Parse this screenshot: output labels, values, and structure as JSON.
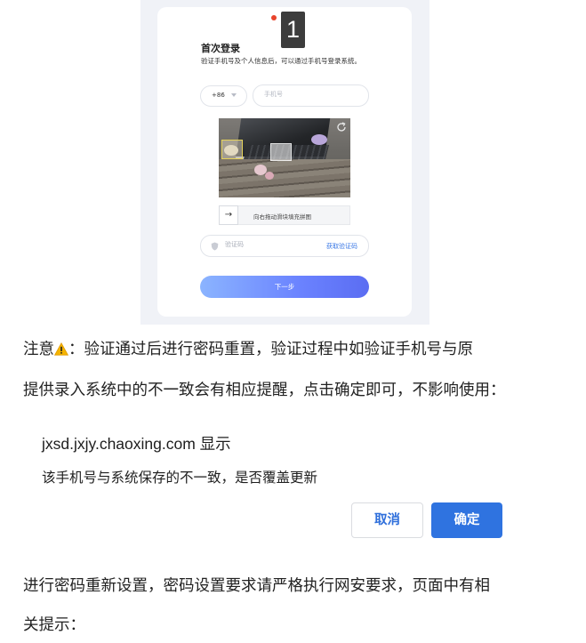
{
  "login": {
    "step_number": "1",
    "title": "首次登录",
    "subtitle": "验证手机号及个人信息后，可以通过手机号登录系统。",
    "country_code": "+86",
    "phone_placeholder": "手机号",
    "slider_hint": "向右拖动滑块填充拼图",
    "slider_arrow": "→",
    "code_placeholder": "验证码",
    "get_code_label": "获取验证码",
    "next_label": "下一步"
  },
  "para1": {
    "line1_before": "注意",
    "line1_after": "：验证通过后进行密码重置，验证过程中如验证手机号与原",
    "line2": "提供录入系统中的不一致会有相应提醒，点击确定即可，不影响使用："
  },
  "dialog": {
    "host": "jxsd.jxjy.chaoxing.com 显示",
    "message": "该手机号与系统保存的不一致，是否覆盖更新",
    "cancel_label": "取消",
    "ok_label": "确定"
  },
  "para2": {
    "line1": "进行密码重新设置，密码设置要求请严格执行网安要求，页面中有相",
    "line2": "关提示："
  },
  "colors": {
    "accent_blue": "#2f73e0",
    "gradient_start": "#8bb4ff",
    "gradient_end": "#5b6df2",
    "warning_yellow": "#f5b400"
  },
  "icons": [
    "refresh-icon",
    "shield-icon",
    "warning-icon",
    "arrow-right-icon",
    "chevron-down-icon"
  ]
}
